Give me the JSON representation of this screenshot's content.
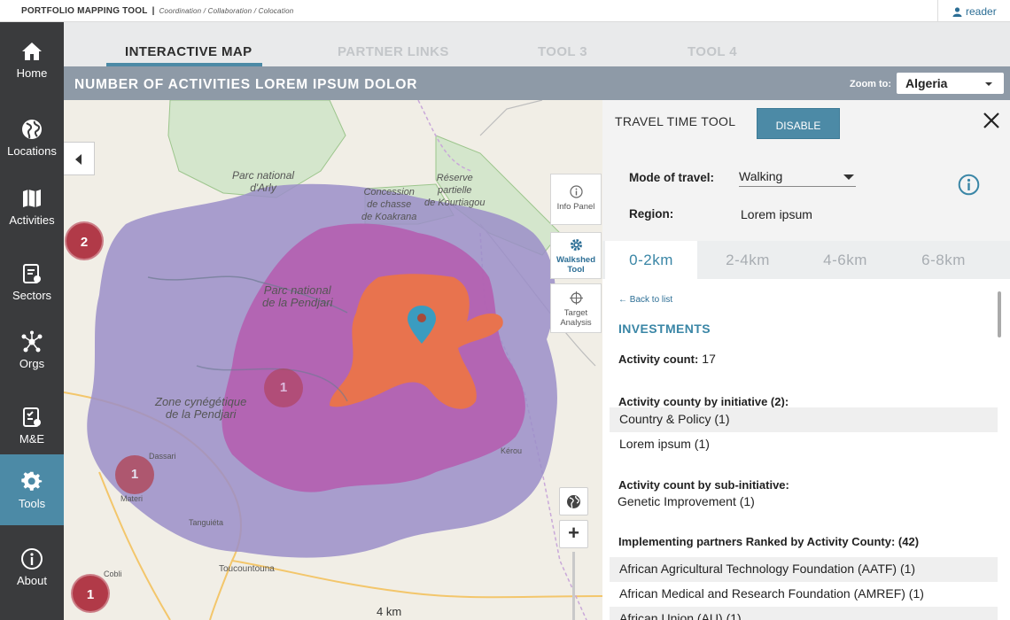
{
  "app": {
    "title": "PORTFOLIO MAPPING TOOL",
    "separator": "|",
    "subtitle": "Coordination / Collaboration / Colocation",
    "user": "reader"
  },
  "sidebar": {
    "items": [
      {
        "label": "Home",
        "icon": "home-icon"
      },
      {
        "label": "Locations",
        "icon": "globe-icon"
      },
      {
        "label": "Activities",
        "icon": "map-icon"
      },
      {
        "label": "Sectors",
        "icon": "clipboard-icon"
      },
      {
        "label": "Orgs",
        "icon": "network-icon"
      },
      {
        "label": "M&E",
        "icon": "checklist-icon"
      },
      {
        "label": "Tools",
        "icon": "gear-icon",
        "active": true
      },
      {
        "label": "About",
        "icon": "info-icon"
      }
    ]
  },
  "tabs": [
    {
      "label": "INTERACTIVE MAP",
      "active": true
    },
    {
      "label": "PARTNER LINKS"
    },
    {
      "label": "TOOL 3"
    },
    {
      "label": "TOOL 4"
    }
  ],
  "titlebar": {
    "title": "NUMBER OF ACTIVITIES LOREM IPSUM DOLOR",
    "zoom_label": "Zoom to:",
    "zoom_value": "Algeria"
  },
  "map": {
    "labels": {
      "arly": "Parc national\nd'Arly",
      "chasse": "Concession\nde chasse\nde Koakrana",
      "reserve": "Réserve\npartielle\nde Kourtiagou",
      "pendjari": "Parc national\nde la Pendjari",
      "zone": "Zone cynégétique\nde la Pendjari",
      "dassari": "Dassari",
      "materi": "Materi",
      "kerou": "Kérou",
      "tanguieta": "Tanguiéta",
      "toucountouna": "Toucountouna",
      "cobli": "Cobli"
    },
    "clusters": [
      "2",
      "1",
      "1",
      "1"
    ],
    "tools": {
      "info": "Info Panel",
      "walkshed": "Walkshed\nTool",
      "target": "Target\nAnalysis"
    },
    "scale": "4 km",
    "colors": {
      "walkshed_outer": "#9b8ec8",
      "walkshed_mid": "#b45fb0",
      "walkshed_inner": "#e8734e",
      "cluster": "#b13a48",
      "marker": "#3a9cc0"
    }
  },
  "panel": {
    "title": "TRAVEL TIME TOOL",
    "disable_label": "DISABLE",
    "mode_label": "Mode of travel:",
    "mode_value": "Walking",
    "region_label": "Region:",
    "region_value": "Lorem ipsum",
    "distance_tabs": [
      "0-2km",
      "2-4km",
      "4-6km",
      "6-8km"
    ],
    "back_label": "Back to list",
    "section_title": "INVESTMENTS",
    "activity_count_label": "Activity count:",
    "activity_count_value": "17",
    "by_initiative_label": "Activity county by initiative (2):",
    "initiatives": [
      "Country & Policy (1)",
      "Lorem ipsum (1)"
    ],
    "by_sub_label": "Activity count by sub-initiative:",
    "sub_initiatives": [
      "Genetic Improvement (1)"
    ],
    "partners_label": "Implementing partners Ranked by Activity County: (42)",
    "partners": [
      "African Agricultural Technology Foundation (AATF) (1)",
      "African Medical and Research Foundation (AMREF) (1)",
      "African Union (AU) (1)"
    ]
  }
}
